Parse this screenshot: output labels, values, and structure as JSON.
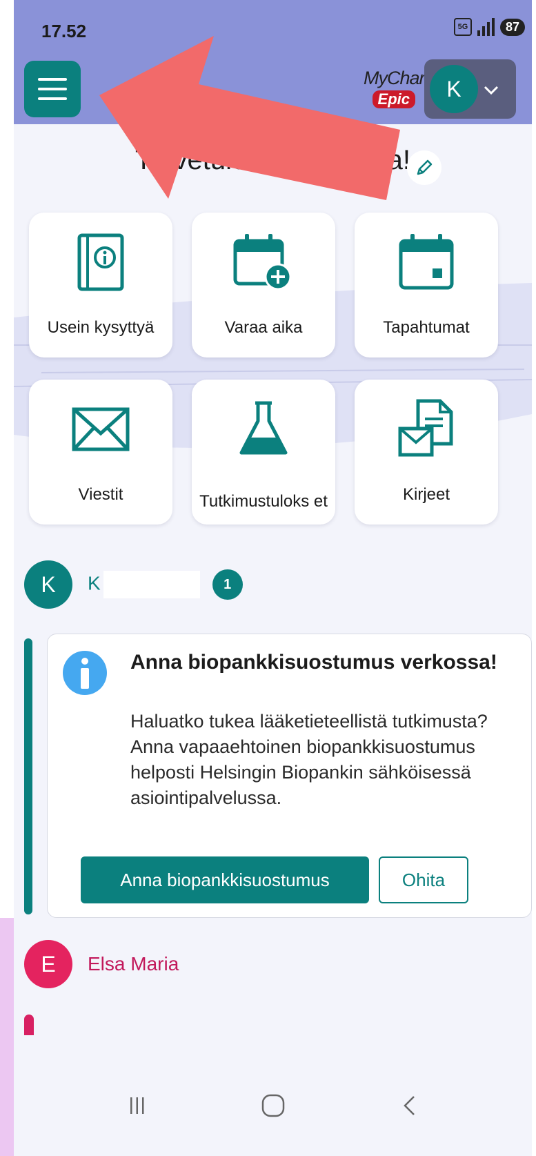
{
  "status_bar": {
    "time": "17.52",
    "network": "5G",
    "battery": "87"
  },
  "header": {
    "menu_icon": "hamburger-menu-icon",
    "logo_top": "MyChart",
    "logo_bottom": "Epic",
    "account_initial": "K",
    "account_chevron": "⌄"
  },
  "greeting": {
    "text": "Tervetuloa, Ka",
    "suffix": "a!"
  },
  "tiles": [
    {
      "label": "Usein kysyttyä",
      "icon": "faq-book-icon"
    },
    {
      "label": "Varaa aika",
      "icon": "calendar-add-icon"
    },
    {
      "label": "Tapahtumat",
      "icon": "calendar-icon"
    },
    {
      "label": "Viestit",
      "icon": "envelope-icon"
    },
    {
      "label": "Tutkimustuloks et",
      "icon": "flask-icon"
    },
    {
      "label": "Kirjeet",
      "icon": "letters-icon"
    }
  ],
  "patients": [
    {
      "initial": "K",
      "name": "K",
      "badge": "1",
      "color": "#0b807e",
      "name_color": "#0b807e"
    },
    {
      "initial": "E",
      "name": "Elsa Maria",
      "color": "#e4235f",
      "name_color": "#c2185b"
    }
  ],
  "notice": {
    "title": "Anna biopankkisuostumus verkossa!",
    "body": "Haluatko tukea lääketieteellistä tutkimusta? Anna vapaaehtoinen biopankkisuostumus helposti Helsingin Biopankin sähköisessä asiointipalvelussa.",
    "primary_button": "Anna biopankkisuostumus",
    "secondary_button": "Ohita"
  },
  "colors": {
    "accent": "#0b807e",
    "header_bg": "#8a92d8",
    "info_blue": "#45a8f0",
    "arrow_red": "#f26a6a"
  }
}
